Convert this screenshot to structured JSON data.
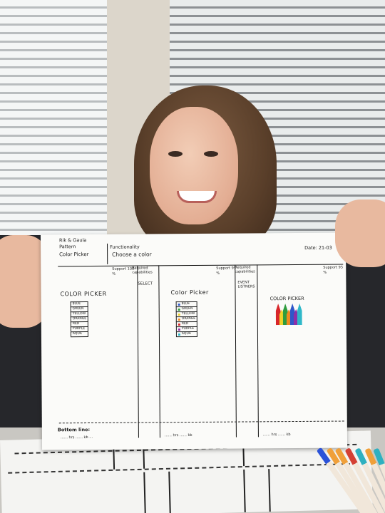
{
  "sheet": {
    "header": {
      "authors": "Rik & Gaula",
      "pattern_label": "Pattern",
      "pattern_value": "Color Picker",
      "functionality_label": "Functionality",
      "functionality_value": "Choose a color",
      "date": "Date: 21-03"
    },
    "columns": [
      {
        "support": "Support 100 %",
        "title": "COLOR PICKER",
        "capabilities_label": "Required capabilities",
        "capabilities_value": "SELECT",
        "list": [
          "BLUE",
          "GREEN",
          "YELLOW",
          "ORANGE",
          "RED",
          "PURPLE",
          "AQUA"
        ],
        "footer": "…… hrs   …… kb   …"
      },
      {
        "support": "Support 95 %",
        "title": "Color Picker",
        "capabilities_label": "Required capabilities",
        "capabilities_value": "EVENT LISTNERS",
        "list": [
          "BLUE",
          "GREEN",
          "YELLOW",
          "ORANGE",
          "RED",
          "PURPLE",
          "AQUA"
        ],
        "footer": "…… hrs   …… kb"
      },
      {
        "support": "Support 95 %",
        "title": "COLOR PICKER",
        "footer": "…… hrs   …… kb"
      }
    ],
    "bottom_line": "Bottom line:"
  },
  "colors": {
    "blue": "#2f57c9",
    "green": "#2e9c3f",
    "yellow": "#f0d22a",
    "orange": "#f08a1e",
    "red": "#d8262a",
    "purple": "#8e2fa8",
    "aqua": "#2fb8c9",
    "pen_orange": "#f0a03a",
    "pen_teal": "#2fb0c0",
    "pen_blue": "#2b52d8",
    "pen_red": "#d44034"
  }
}
